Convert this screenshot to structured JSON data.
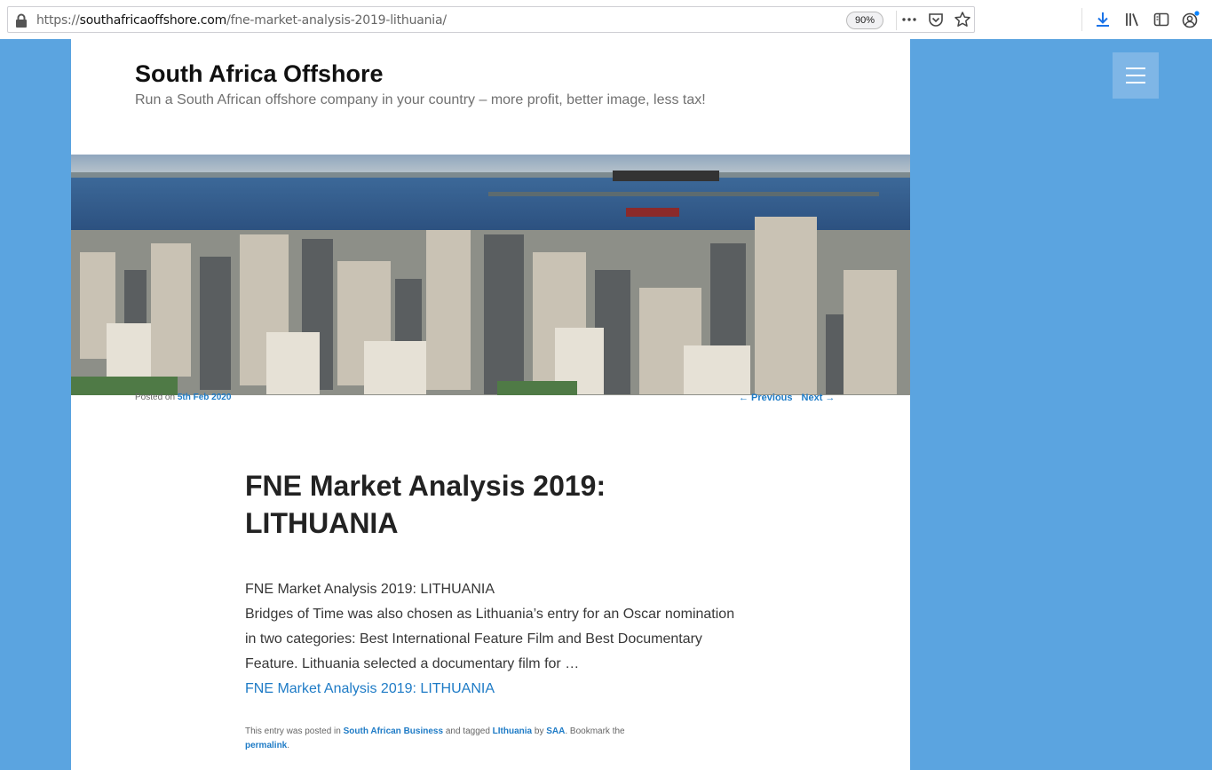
{
  "browser": {
    "url_prefix": "https://",
    "url_host": "southafricaoffshore.com",
    "url_path": "/fne-market-analysis-2019-lithuania/",
    "zoom": "90%"
  },
  "site": {
    "title": "South Africa Offshore",
    "description": "Run a South African offshore company in your country – more profit, better image, less tax!"
  },
  "meta": {
    "posted_on": "Posted on",
    "date": "5th Feb 2020",
    "prev": "← Previous",
    "next": "Next →"
  },
  "post": {
    "title": "FNE Market Analysis 2019: LITHUANIA",
    "line1": "FNE Market Analysis 2019: LITHUANIA",
    "excerpt": "Bridges of Time was also chosen as Lithuania’s entry for an Oscar nomination in two categories: Best International Feature Film and Best Documentary Feature. Lithuania selected a documentary film for …",
    "more_link": "FNE Market Analysis 2019: LITHUANIA"
  },
  "footer": {
    "t1": "This entry was posted in ",
    "category": "South African Business",
    "t2": " and tagged ",
    "tag": "LIthuania",
    "t3": " by ",
    "author": "SAA",
    "t4": ". Bookmark the ",
    "permalink": "permalink",
    "t5": "."
  },
  "colors": {
    "page_bg": "#5ba4e0",
    "link": "#1e7bc6",
    "menu_button": "#7fb6e6"
  },
  "icons": [
    "lock-icon",
    "more-dots-icon",
    "pocket-icon",
    "star-icon",
    "download-icon",
    "library-icon",
    "sidebar-icon",
    "account-icon",
    "menu-icon"
  ]
}
